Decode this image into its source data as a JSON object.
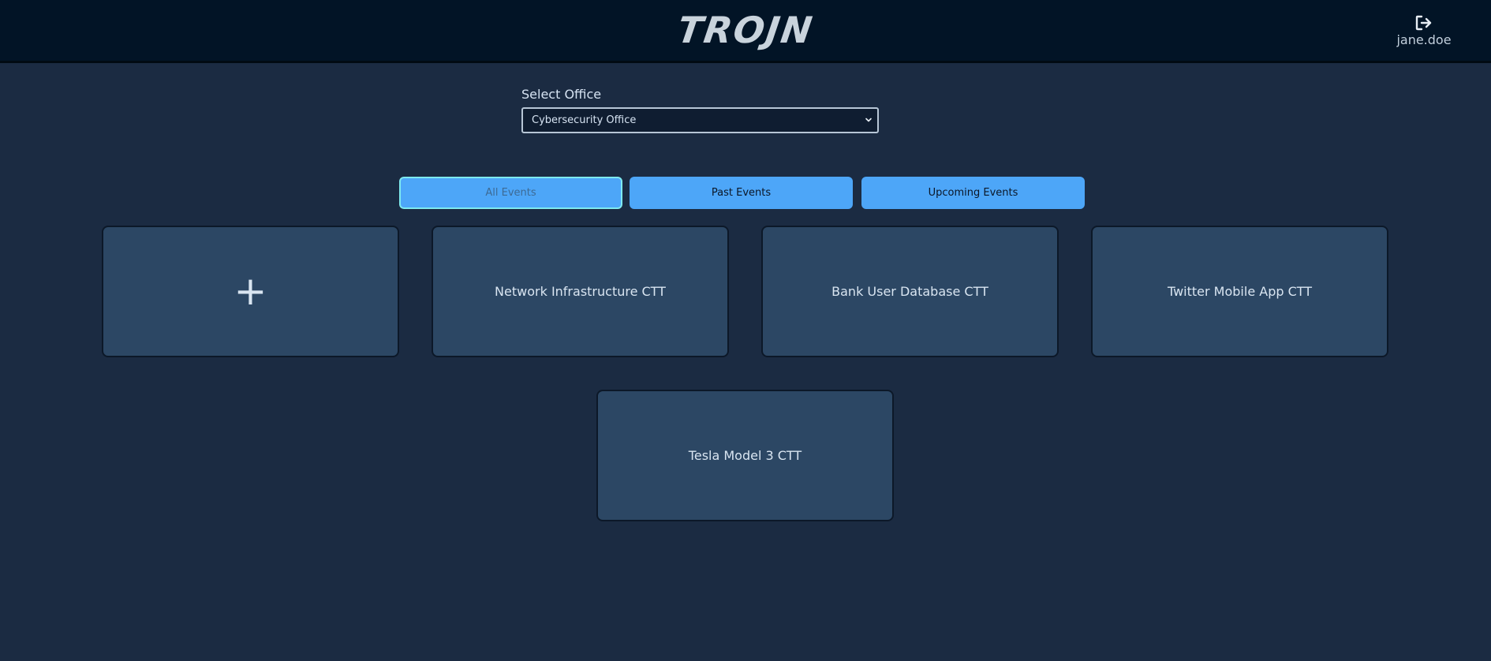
{
  "header": {
    "logo_text": "TROJN",
    "username": "jane.doe",
    "logout_icon": "logout-icon"
  },
  "office": {
    "label": "Select Office",
    "selected": "Cybersecurity Office"
  },
  "filters": [
    {
      "label": "All Events",
      "active": true
    },
    {
      "label": "Past Events",
      "active": false
    },
    {
      "label": "Upcoming Events",
      "active": false
    }
  ],
  "cards": {
    "add_symbol": "+",
    "events": [
      "Network Infrastructure CTT",
      "Bank User Database CTT",
      "Twitter Mobile App CTT",
      "Tesla Model 3 CTT"
    ]
  },
  "colors": {
    "background": "#1b2b42",
    "topbar": "#021426",
    "card": "#2c4764",
    "button": "#4da6f8",
    "active_border": "#7ee9ee"
  }
}
